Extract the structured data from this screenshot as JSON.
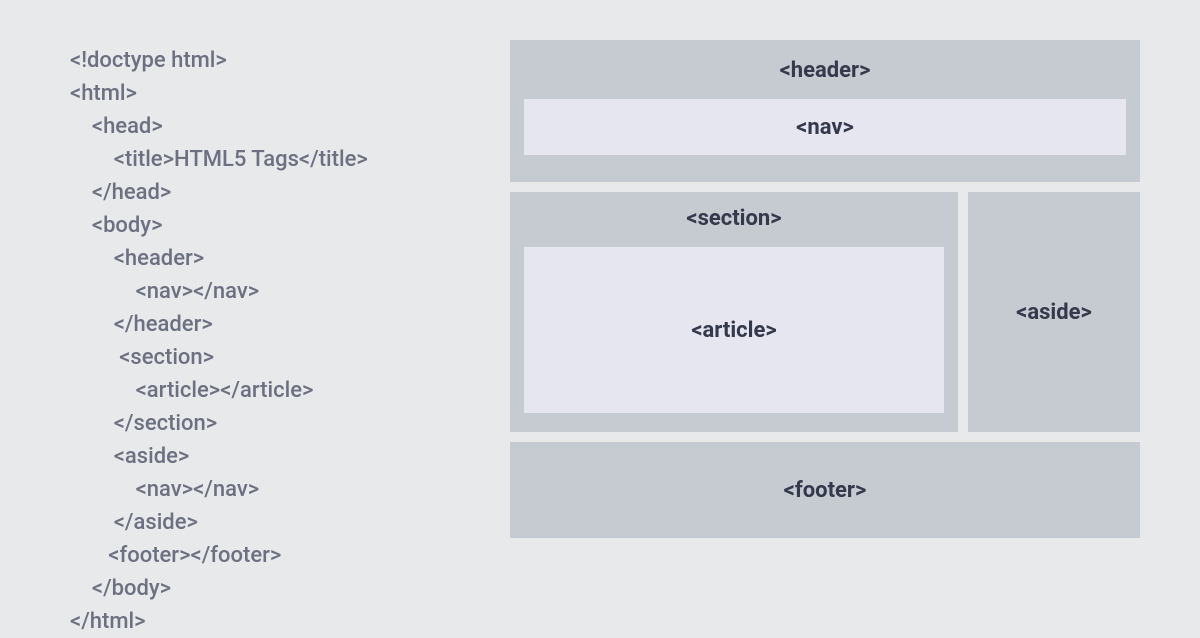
{
  "code": {
    "l1": "<!doctype html>",
    "l2": "<html>",
    "l3": "    <head>",
    "l4": "        <title>HTML5 Tags</title>",
    "l5": "    </head>",
    "l6": "    <body>",
    "l7": "        <header>",
    "l8": "            <nav></nav>",
    "l9": "        </header>",
    "l10": "         <section>",
    "l11": "            <article></article>",
    "l12": "        </section>",
    "l13": "        <aside>",
    "l14": "            <nav></nav>",
    "l15": "        </aside>",
    "l16": "       <footer></footer>",
    "l17": "    </body>",
    "l18": "</html>"
  },
  "layout": {
    "header": "<header>",
    "nav": "<nav>",
    "section": "<section>",
    "article": "<article>",
    "aside": "<aside>",
    "footer": "<footer>"
  }
}
